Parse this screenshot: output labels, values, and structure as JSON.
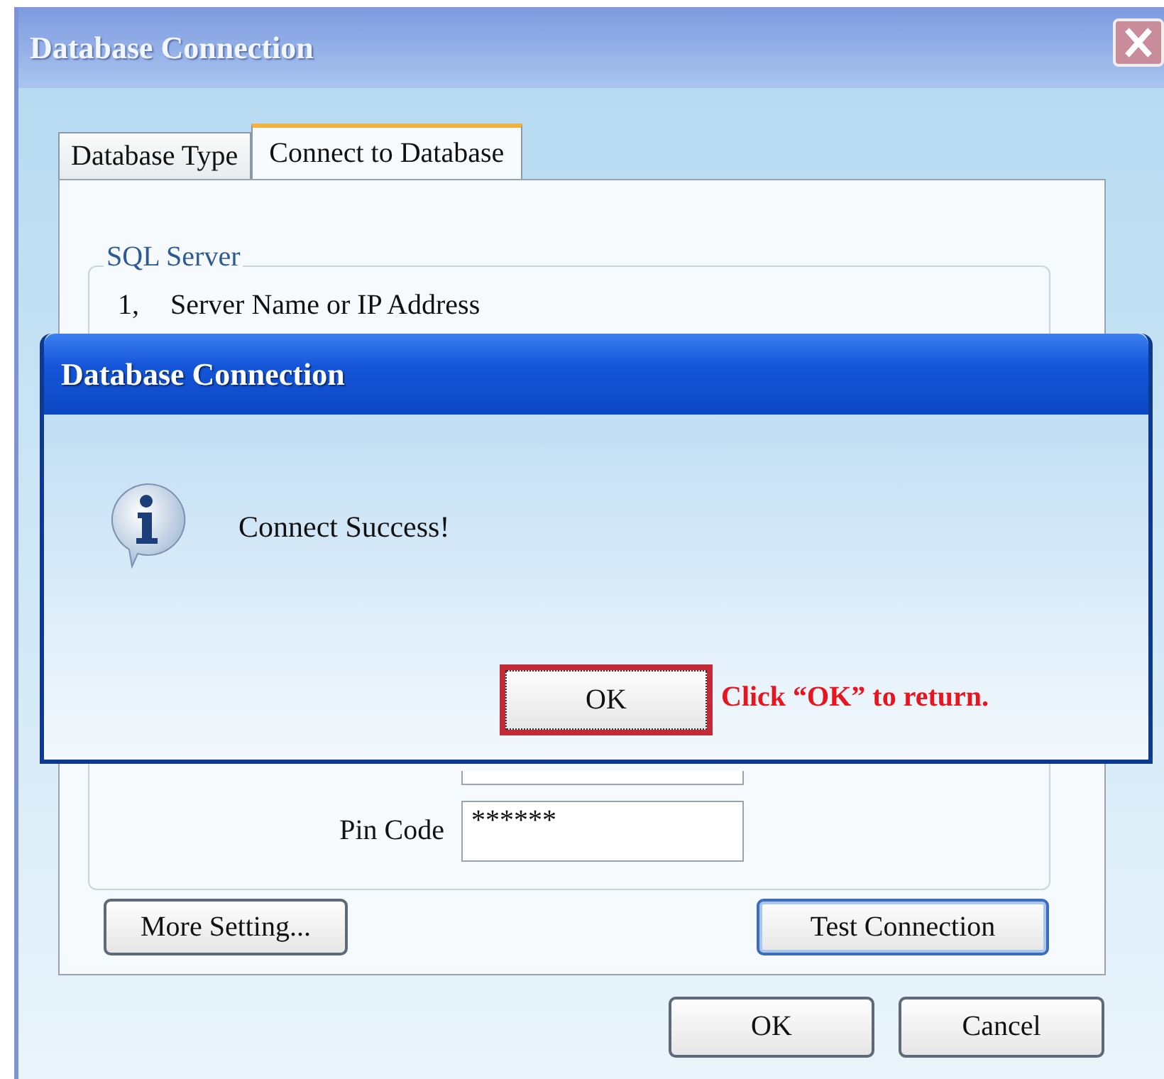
{
  "window": {
    "title": "Database Connection"
  },
  "tabs": [
    {
      "label": "Database Type",
      "selected": false
    },
    {
      "label": "Connect to Database",
      "selected": true
    }
  ],
  "group": {
    "title": "SQL Server",
    "step_number": "1,",
    "step_label": "Server Name or IP Address"
  },
  "pin_code": {
    "label": "Pin Code",
    "value": "******"
  },
  "panel_buttons": [
    {
      "label": "More Setting...",
      "focused": false
    },
    {
      "label": "Test Connection",
      "focused": true
    }
  ],
  "footer_buttons": [
    "OK",
    "Cancel"
  ],
  "message_box": {
    "title": "Database Connection",
    "message": "Connect Success!",
    "button": "OK",
    "highlighted": true
  },
  "annotation": "Click “OK” to return."
}
